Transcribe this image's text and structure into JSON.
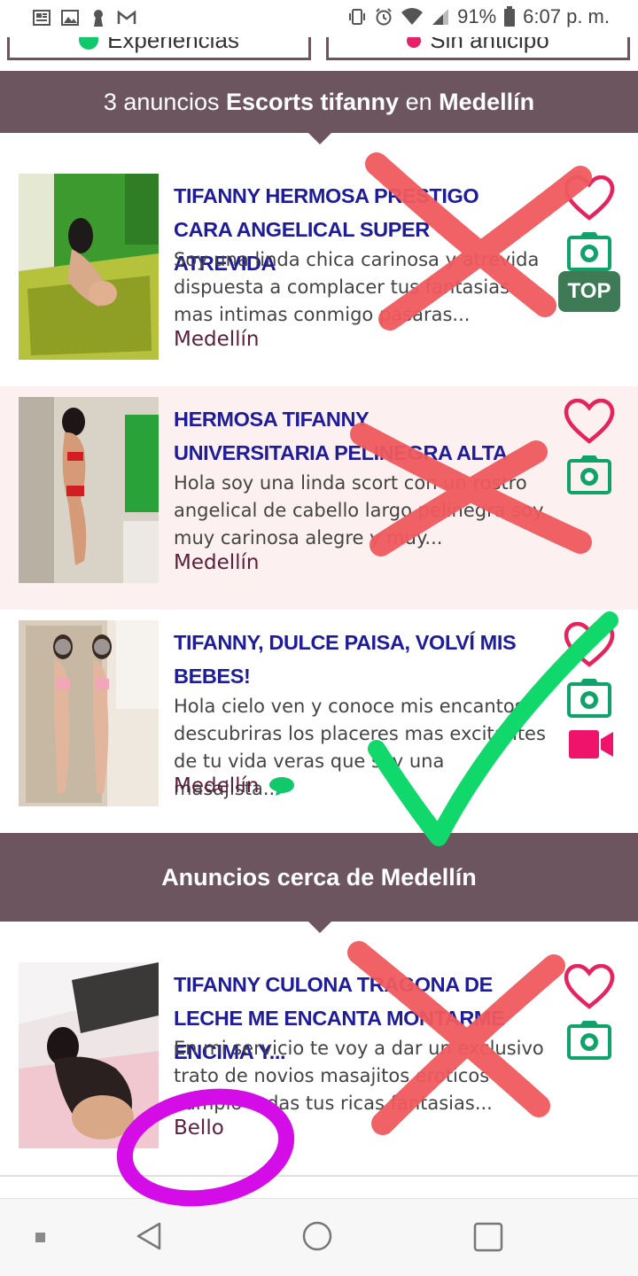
{
  "status_bar": {
    "battery": "91%",
    "time": "6:07 p. m.",
    "left_icons": [
      "news-icon",
      "image-icon",
      "keyhole-icon",
      "gmail-icon"
    ],
    "right_icons": [
      "vibrate-icon",
      "alarm-icon",
      "wifi-icon",
      "signal-icon",
      "battery-icon"
    ]
  },
  "filters": [
    {
      "label": "Experiencias",
      "icon": "chat-bubble-icon",
      "icon_color": "#11c96a"
    },
    {
      "label": "Sin anticipo",
      "icon": "flower-icon",
      "icon_color": "#e52267"
    }
  ],
  "results_header": {
    "count_text": "3 anuncios",
    "query": "Escorts tifanny",
    "connector": "en",
    "city": "Medellín"
  },
  "listings": [
    {
      "title": "TIFANNY HERMOSA PRESTIGO CARA ANGELICAL SUPER ATREVIDA",
      "description": "Soy una linda chica carinosa y atrevida dispuesta a complacer tus fantasias mas intimas conmigo pasaras...",
      "location": "Medellín",
      "has_chat": false,
      "has_video": false,
      "badge": "TOP"
    },
    {
      "title": "HERMOSA TIFANNY UNIVERSITARIA PELINEGRA ALTA",
      "description": "Hola soy una linda scort con un rostro angelical de cabello largo pelinegra soy muy carinosa alegre y muy...",
      "location": "Medellín",
      "has_chat": false,
      "has_video": false,
      "badge": ""
    },
    {
      "title": "TIFANNY, DULCE PAISA, VOLVÍ MIS BEBES!",
      "description": "Hola cielo ven y conoce mis encantos descubriras los placeres mas excitantes de tu vida veras que soy una masajista...",
      "location": "Medellín",
      "has_chat": true,
      "has_video": true,
      "badge": ""
    }
  ],
  "nearby_header": "Anuncios cerca de Medellín",
  "nearby_listings": [
    {
      "title": "TIFANNY CULONA TRAGONA DE LECHE ME ENCANTA MONTARME ENCIMA Y...",
      "description": "En mi servicio te voy a dar un exclusivo trato de novios masajitos eroticos cumplo todas tus ricas fantasias...",
      "location": "Bello"
    }
  ],
  "colors": {
    "header_bg": "#6d5560",
    "title_blue": "#1e1c99",
    "location_maroon": "#5a1f3b",
    "heart_pink": "#e5245f",
    "camera_green": "#0fa36a",
    "top_badge": "#3e7a55",
    "video_pink": "#f0136b",
    "alt_row_bg": "#fcf0f0",
    "annot_red": "#f05a5e",
    "annot_green": "#10d86a",
    "annot_magenta": "#d40ce8"
  },
  "navigation": [
    "back-icon",
    "home-icon",
    "recents-icon"
  ]
}
